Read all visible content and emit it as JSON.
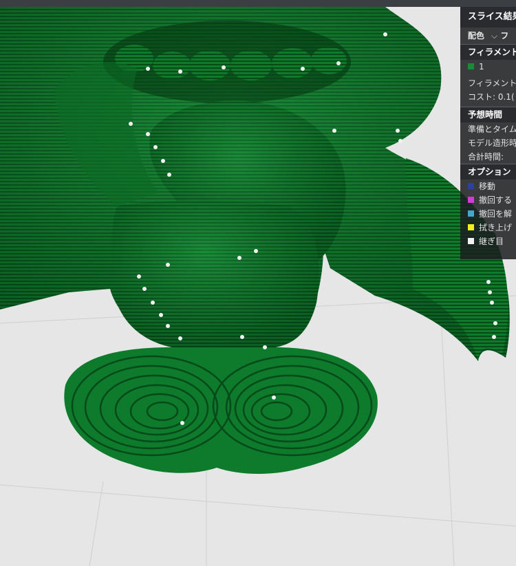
{
  "panel": {
    "title": "スライス結果",
    "color_scheme": {
      "label": "配色",
      "value": "フ"
    },
    "filament": {
      "header": "フィラメント",
      "items": [
        {
          "label": "1",
          "color": "#1b8a3a"
        }
      ],
      "used_label": "フィラメント",
      "cost_label": "コスト: 0.1("
    },
    "time": {
      "header": "予想時間",
      "prep_label": "準備とタイム",
      "model_label": "モデル造形時",
      "total_label": "合計時間:"
    },
    "options": {
      "header": "オプション",
      "items": [
        {
          "label": "移動",
          "color": "#2e3f9c"
        },
        {
          "label": "撤回する",
          "color": "#d43bd4"
        },
        {
          "label": "撤回を解",
          "color": "#4aa3c9"
        },
        {
          "label": "拭き上げ",
          "color": "#f2ef1c"
        },
        {
          "label": "継ぎ目",
          "color": "#f2f2f2"
        }
      ]
    }
  },
  "colors": {
    "model": "#0f7a2a",
    "bed": "#e6e6e6",
    "seam": "#ffffff"
  }
}
